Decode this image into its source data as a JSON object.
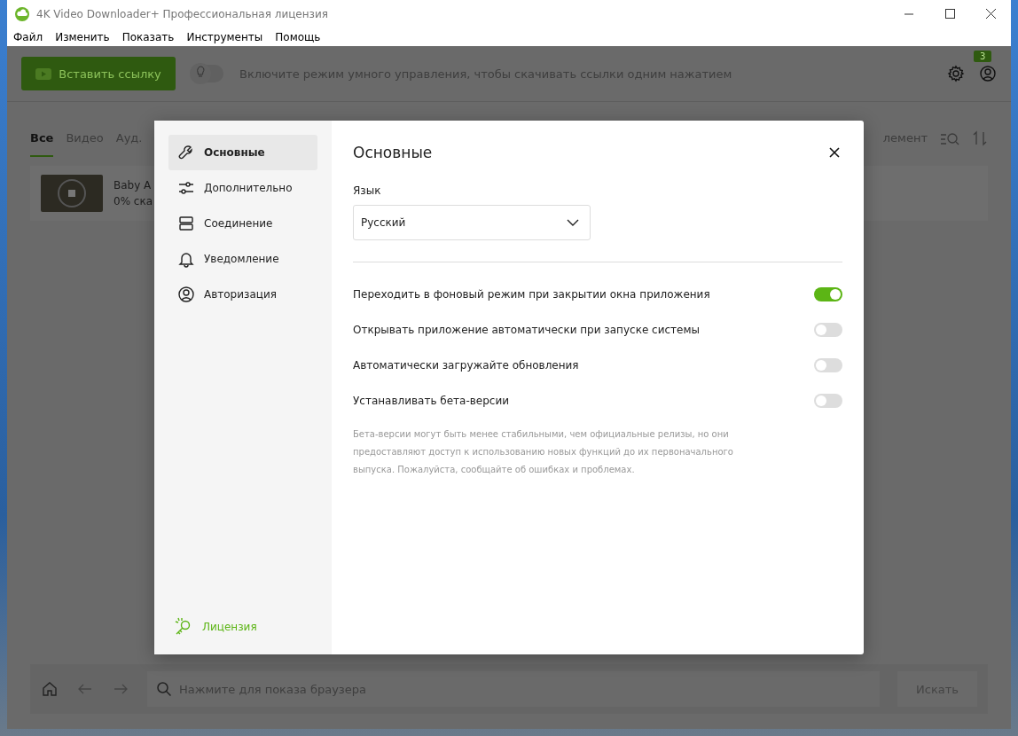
{
  "window": {
    "title": "4K Video Downloader+ Профессиональная лицензия"
  },
  "menu": [
    "Файл",
    "Изменить",
    "Показать",
    "Инструменты",
    "Помощь"
  ],
  "toolbar": {
    "paste_button": "Вставить ссылку",
    "smart_mode": {
      "on": false,
      "label": "Включите режим умного управления, чтобы скачивать ссылки одним нажатием"
    },
    "notification_badge": "3"
  },
  "tabs": [
    {
      "label": "Все",
      "selected": true
    },
    {
      "label": "Видео",
      "selected": false
    },
    {
      "label": "Ауд.",
      "selected": false
    }
  ],
  "list_header_text": "лемент",
  "downloads": [
    {
      "title": "Baby A",
      "status": "0% ска"
    }
  ],
  "browser_bar": {
    "placeholder": "Нажмите для показа браузера",
    "search_button": "Искать"
  },
  "settings": {
    "nav": [
      {
        "label": "Основные",
        "kind": "wrench",
        "selected": true
      },
      {
        "label": "Дополнительно",
        "kind": "sliders",
        "selected": false
      },
      {
        "label": "Соединение",
        "kind": "server",
        "selected": false
      },
      {
        "label": "Уведомление",
        "kind": "bell",
        "selected": false
      },
      {
        "label": "Авторизация",
        "kind": "user",
        "selected": false
      }
    ],
    "license_link": "Лицензия",
    "title": "Основные",
    "language": {
      "label": "Язык",
      "value": "Русский"
    },
    "options": [
      {
        "label": "Переходить в фоновый режим при закрытии окна приложения",
        "on": true
      },
      {
        "label": "Открывать приложение автоматически при запуске системы",
        "on": false
      },
      {
        "label": "Автоматически загружайте обновления",
        "on": false
      },
      {
        "label": "Устанавливать бета-версии",
        "on": false
      }
    ],
    "note": "Бета-версии могут быть менее стабильными, чем официальные релизы, но они предоставляют доступ к использованию новых функций до их первоначального выпуска. Пожалуйста, сообщайте об ошибках и проблемах."
  }
}
